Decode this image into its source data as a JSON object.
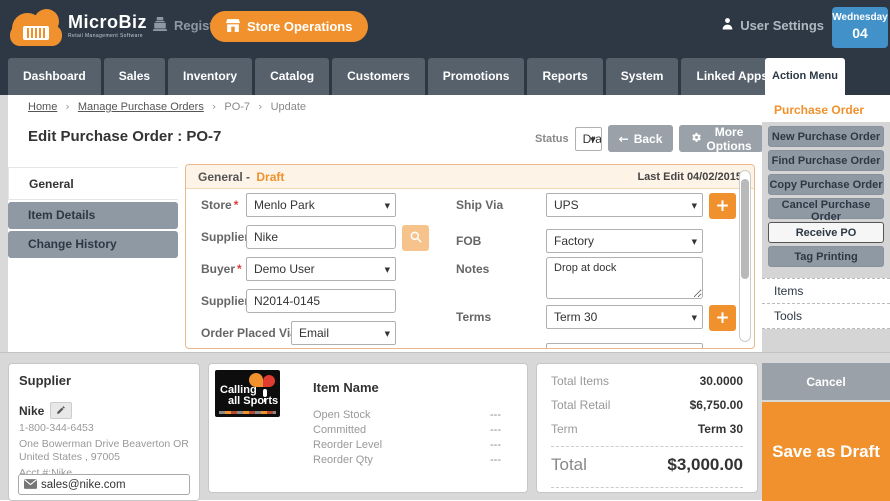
{
  "colors": {
    "accent_orange": "#f0912d",
    "dark_navy": "#2d3844",
    "badge_blue": "#4291c8",
    "button_gray": "#9ba1a8"
  },
  "icons": {
    "dropdown": "▼",
    "back_arrow": "←",
    "breadcrumb_separator": "›",
    "plus": "+"
  },
  "topbar": {
    "brand_name": "MicroBiz",
    "brand_tagline": "Retail Management Software",
    "register_label": "Register",
    "store_operations_label": "Store Operations",
    "user_settings_label": "User Settings",
    "date_day": "Wednesday",
    "date_num": "04"
  },
  "nav": {
    "items": [
      "Dashboard",
      "Sales",
      "Inventory",
      "Catalog",
      "Customers",
      "Promotions",
      "Reports",
      "System",
      "Linked Apps"
    ]
  },
  "breadcrumb": {
    "items": [
      "Home",
      "Manage Purchase Orders",
      "PO-7",
      "Update"
    ]
  },
  "page": {
    "title": "Edit Purchase Order : PO-7"
  },
  "status_bar": {
    "status_label": "Status",
    "status_value": "Draft",
    "back_label": "Back",
    "more_options_label": "More Options"
  },
  "side_tabs": {
    "general": "General",
    "item_details": "Item Details",
    "change_history": "Change History"
  },
  "form": {
    "required_mark": "*",
    "header": {
      "title": "General -",
      "status": "Draft",
      "last_edit": "Last Edit 04/02/2015"
    },
    "fields": {
      "store": {
        "label": "Store",
        "value": "Menlo Park"
      },
      "supplier": {
        "label": "Supplier",
        "value": "Nike"
      },
      "buyer": {
        "label": "Buyer",
        "value": "Demo User"
      },
      "supplier_po": {
        "label": "Supplier PO #",
        "value": "N2014-0145"
      },
      "order_placed_via": {
        "label": "Order Placed Via",
        "value": "Email"
      },
      "ship_via": {
        "label": "Ship Via",
        "value": "UPS"
      },
      "fob": {
        "label": "FOB",
        "value": "Factory"
      },
      "notes": {
        "label": "Notes",
        "value": "Drop at dock"
      },
      "terms": {
        "label": "Terms",
        "value": "Term 30"
      }
    }
  },
  "action_menu": {
    "title": "Action Menu",
    "section_label": "Purchase Order",
    "buttons": [
      "New Purchase Order",
      "Find Purchase Order",
      "Copy Purchase Order",
      "Cancel Purchase Order",
      "Receive PO",
      "Tag Printing"
    ],
    "links": [
      "Items",
      "Tools"
    ]
  },
  "supplier_panel": {
    "title": "Supplier",
    "name": "Nike",
    "phone": "1-800-344-6453",
    "address": "One Bowerman Drive Beaverton OR United States , 97005",
    "account": "Acct #:Nike",
    "email": "sales@nike.com"
  },
  "item_panel": {
    "logo_line1": "Calling",
    "logo_line2": "all Sports",
    "title": "Item Name",
    "rows": [
      {
        "label": "Open Stock",
        "value": "---"
      },
      {
        "label": "Committed",
        "value": "---"
      },
      {
        "label": "Reorder Level",
        "value": "---"
      },
      {
        "label": "Reorder Qty",
        "value": "---"
      }
    ]
  },
  "totals_panel": {
    "rows": [
      {
        "label": "Total Items",
        "value": "30.0000"
      },
      {
        "label": "Total Retail",
        "value": "$6,750.00"
      },
      {
        "label": "Term",
        "value": "Term 30"
      }
    ],
    "total_label": "Total",
    "total_value": "$3,000.00"
  },
  "footer_actions": {
    "cancel": "Cancel",
    "save": "Save as Draft"
  }
}
